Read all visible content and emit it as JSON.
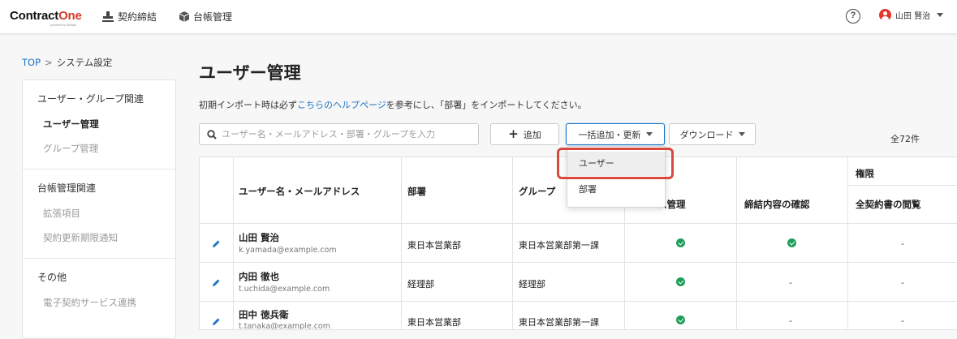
{
  "header": {
    "logo_main": "Contract",
    "logo_accent": "One",
    "logo_sub": "powered by Sansan",
    "nav": [
      {
        "label": "契約締結",
        "icon": "stamp-icon"
      },
      {
        "label": "台帳管理",
        "icon": "box-icon"
      }
    ],
    "help_label": "?",
    "user_name": "山田 賢治"
  },
  "breadcrumb": {
    "root": "TOP",
    "separator": ">",
    "current": "システム設定"
  },
  "sidebar": {
    "sections": [
      {
        "heading": "ユーザー・グループ関連",
        "items": [
          "ユーザー管理",
          "グループ管理"
        ],
        "active": 0
      },
      {
        "heading": "台帳管理関連",
        "items": [
          "拡張項目",
          "契約更新期限通知"
        ]
      },
      {
        "heading": "その他",
        "items": [
          "電子契約サービス連携"
        ]
      }
    ]
  },
  "main": {
    "title": "ユーザー管理",
    "notice_pre": "初期インポート時は必ず",
    "notice_link": "こちらのヘルプページ",
    "notice_post": "を参考にし、「部署」をインポートしてください。",
    "search_placeholder": "ユーザー名・メールアドレス・部署・グループを入力",
    "add_label": "追加",
    "bulk_label": "一括追加・更新",
    "download_label": "ダウンロード",
    "total": "全72件"
  },
  "dropdown": {
    "items": [
      "ユーザー",
      "部署"
    ]
  },
  "table": {
    "headers": {
      "name": "ユーザー名・メールアドレス",
      "dept": "部署",
      "group": "グループ",
      "perm_group": "権限",
      "sys": "ム管理",
      "confirm": "締結内容の確認",
      "view_all": "全契約書の閲覧"
    },
    "rows": [
      {
        "name": "山田 賢治",
        "email": "k.yamada@example.com",
        "dept": "東日本営業部",
        "group": "東日本営業部第一課",
        "sys": true,
        "confirm": true,
        "view_all": "-"
      },
      {
        "name": "内田 徹也",
        "email": "t.uchida@example.com",
        "dept": "経理部",
        "group": "経理部",
        "sys": true,
        "confirm": "-",
        "view_all": "-"
      },
      {
        "name": "田中 徳兵衛",
        "email": "t.tanaka@example.com",
        "dept": "東日本営業部",
        "group": "東日本営業部第一課",
        "sys": true,
        "confirm": "-",
        "view_all": "-"
      }
    ]
  },
  "colors": {
    "accent_blue": "#1a73c8",
    "brand_red": "#d23a2a",
    "check_green": "#1e9e5a",
    "highlight_red": "#d94a3e"
  }
}
